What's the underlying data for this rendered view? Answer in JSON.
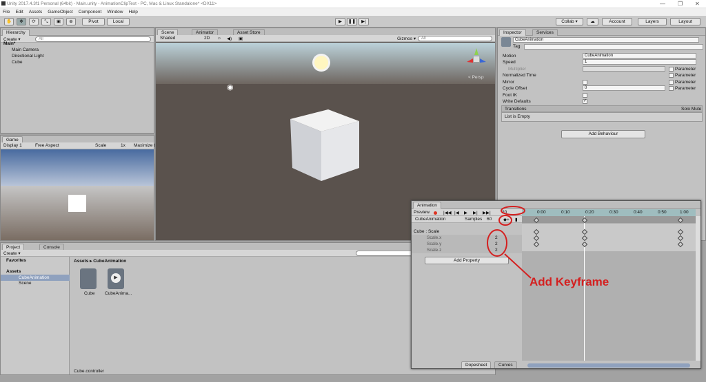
{
  "window": {
    "title": "Unity 2017.4.3f1 Personal (64bit) - Main.unity - AnimationClipTest - PC, Mac & Linux Standalone* <DX11>"
  },
  "menu": [
    "File",
    "Edit",
    "Assets",
    "GameObject",
    "Component",
    "Window",
    "Help"
  ],
  "toolbar": {
    "pivot": "Pivot",
    "local": "Local",
    "collab": "Collab ▾",
    "account": "Account",
    "layers": "Layers",
    "layout": "Layout"
  },
  "hierarchy": {
    "tab": "Hierarchy",
    "create": "Create ▾",
    "search": "All",
    "scene": "Main*",
    "items": [
      "Main Camera",
      "Directional Light",
      "Cube"
    ]
  },
  "scene": {
    "tabs": [
      "Scene",
      "Animator",
      "Asset Store"
    ],
    "shaded": "Shaded",
    "mode2d": "2D",
    "gizmos": "Gizmos ▾",
    "search": "All",
    "persp": "< Persp"
  },
  "game": {
    "tab": "Game",
    "display": "Display 1",
    "aspect": "Free Aspect",
    "scale": "Scale",
    "scale_val": "1x",
    "maximize": "Maximize O"
  },
  "inspector": {
    "tabs": [
      "Inspector",
      "Services"
    ],
    "name": "CubeAnimation",
    "tag": "Tag",
    "rows": [
      {
        "label": "Motion",
        "value": "CubeAnimation"
      },
      {
        "label": "Speed",
        "value": "1"
      },
      {
        "label": "Multiplier",
        "value": ""
      },
      {
        "label": "Normalized Time",
        "value": ""
      },
      {
        "label": "Mirror",
        "value": ""
      },
      {
        "label": "Cycle Offset",
        "value": "0"
      },
      {
        "label": "Foot IK",
        "value": ""
      },
      {
        "label": "Write Defaults",
        "value": ""
      }
    ],
    "parameter": "Parameter",
    "transitions": "Transitions",
    "solo_mute": "Solo Mute",
    "empty": "List is Empty",
    "add_behaviour": "Add Behaviour"
  },
  "project": {
    "tabs": [
      "Project",
      "Console"
    ],
    "create": "Create ▾",
    "favorites": "Favorites",
    "assets": "Assets",
    "tree": [
      "CubeAnimation",
      "Scene"
    ],
    "breadcrumb": "Assets ▸ CubeAnimation",
    "files": [
      "Cube",
      "CubeAnima..."
    ],
    "footer": "Cube.controller"
  },
  "animation": {
    "tab": "Animation",
    "preview": "Preview",
    "clip": "CubeAnimation",
    "samples": "Samples",
    "samples_val": "60",
    "frame": "20",
    "ticks": [
      "0:00",
      "0:10",
      "0:20",
      "0:30",
      "0:40",
      "0:50",
      "1:00"
    ],
    "property": "Cube : Scale",
    "props": [
      {
        "name": "Scale.x",
        "value": "2"
      },
      {
        "name": "Scale.y",
        "value": "2"
      },
      {
        "name": "Scale.z",
        "value": "2"
      }
    ],
    "add_property": "Add Property",
    "bottom_tabs": [
      "Dopesheet",
      "Curves"
    ]
  },
  "annotation": "Add Keyframe"
}
